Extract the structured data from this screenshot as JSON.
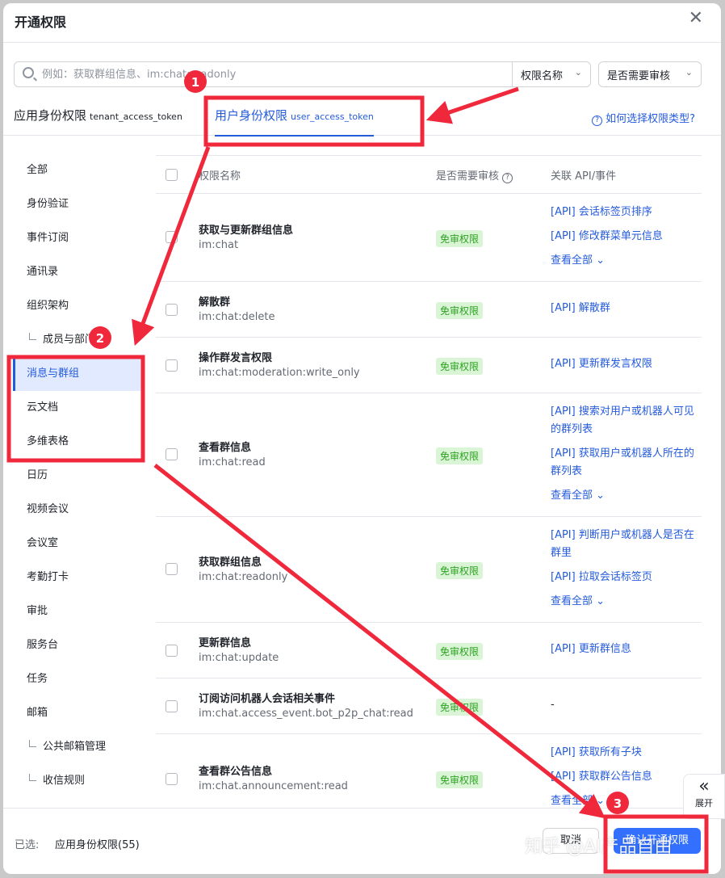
{
  "dialog": {
    "title": "开通权限"
  },
  "search": {
    "placeholder": "例如：获取群组信息、im:chat:readonly"
  },
  "filters": {
    "name_select": "权限名称",
    "review_select": "是否需要审核"
  },
  "tabs": {
    "app": {
      "label": "应用身份权限",
      "token": "tenant_access_token"
    },
    "user": {
      "label": "用户身份权限",
      "token": "user_access_token"
    }
  },
  "help_link": "如何选择权限类型?",
  "sidebar": {
    "items": [
      {
        "label": "全部"
      },
      {
        "label": "身份验证"
      },
      {
        "label": "事件订阅"
      },
      {
        "label": "通讯录"
      },
      {
        "label": "组织架构"
      },
      {
        "label": "成员与部门"
      },
      {
        "label": "消息与群组"
      },
      {
        "label": "云文档"
      },
      {
        "label": "多维表格"
      },
      {
        "label": "日历"
      },
      {
        "label": "视频会议"
      },
      {
        "label": "会议室"
      },
      {
        "label": "考勤打卡"
      },
      {
        "label": "审批"
      },
      {
        "label": "服务台"
      },
      {
        "label": "任务"
      },
      {
        "label": "邮箱"
      },
      {
        "label": "公共邮箱管理"
      },
      {
        "label": "收信规则"
      }
    ],
    "active_label": "消息与群组"
  },
  "table": {
    "headers": {
      "name": "权限名称",
      "review": "是否需要审核",
      "api": "关联 API/事件"
    },
    "rows": [
      {
        "name": "获取与更新群组信息",
        "code": "im:chat",
        "badge": "免审权限",
        "apis": [
          "[API] 会话标签页排序",
          "[API] 修改群菜单元信息"
        ],
        "more": "查看全部"
      },
      {
        "name": "解散群",
        "code": "im:chat:delete",
        "badge": "免审权限",
        "apis": [
          "[API] 解散群"
        ]
      },
      {
        "name": "操作群发言权限",
        "code": "im:chat:moderation:write_only",
        "badge": "免审权限",
        "apis": [
          "[API] 更新群发言权限"
        ]
      },
      {
        "name": "查看群信息",
        "code": "im:chat:read",
        "badge": "免审权限",
        "apis": [
          "[API] 搜索对用户或机器人可见的群列表",
          "[API] 获取用户或机器人所在的群列表"
        ],
        "more": "查看全部"
      },
      {
        "name": "获取群组信息",
        "code": "im:chat:readonly",
        "badge": "免审权限",
        "apis": [
          "[API] 判断用户或机器人是否在群里",
          "[API] 拉取会话标签页"
        ],
        "more": "查看全部"
      },
      {
        "name": "更新群信息",
        "code": "im:chat:update",
        "badge": "免审权限",
        "apis": [
          "[API] 更新群信息"
        ]
      },
      {
        "name": "订阅访问机器人会话相关事件",
        "code": "im:chat.access_event.bot_p2p_chat:read",
        "badge": "免审权限",
        "dash": "-"
      },
      {
        "name": "查看群公告信息",
        "code": "im:chat.announcement:read",
        "badge": "免审权限",
        "apis": [
          "[API] 获取所有子块",
          "[API] 获取群公告信息"
        ],
        "more": "查看全部"
      }
    ]
  },
  "footer": {
    "selected_label": "已选:",
    "selected_value": "应用身份权限(55)",
    "cancel": "取消",
    "confirm": "确认开通权限"
  },
  "expand": {
    "label": "展开"
  },
  "annotations": {
    "badges": [
      "1",
      "2",
      "3"
    ],
    "color": "#f0283c"
  },
  "watermark": "知乎 @AI产品自由"
}
